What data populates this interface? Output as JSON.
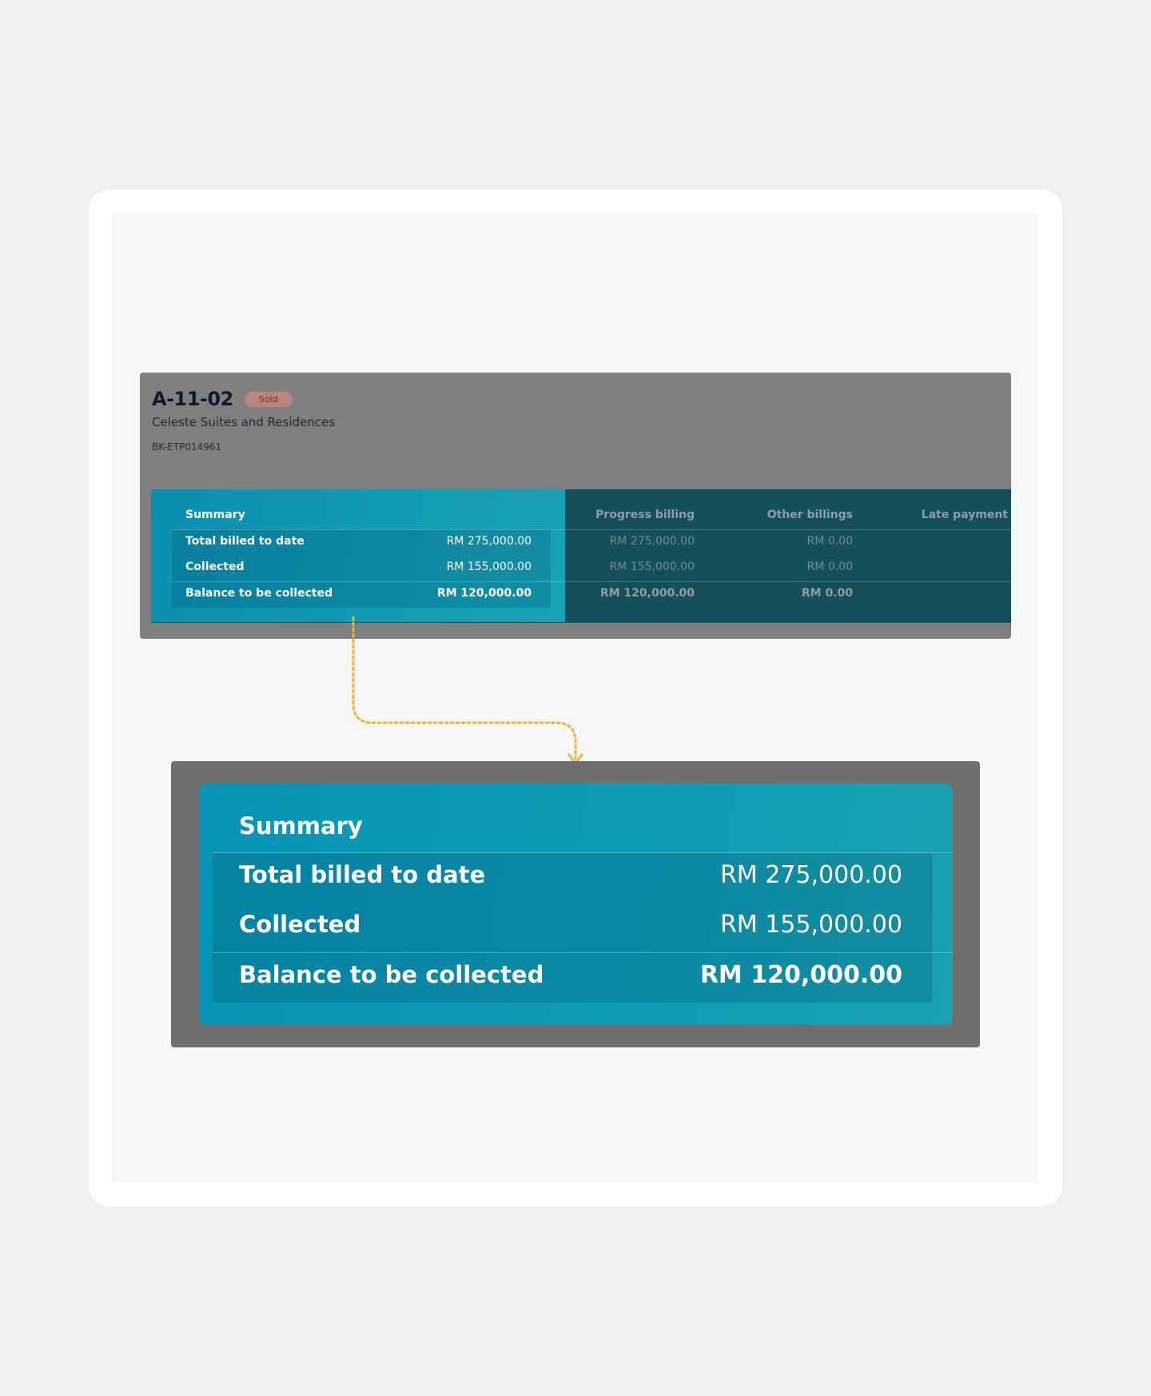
{
  "unit": {
    "code": "A-11-02",
    "status": "Sold",
    "project": "Celeste Suites and Residences",
    "booking_id": "BK-ETP014961"
  },
  "summary": {
    "header": "Summary",
    "rows": [
      {
        "label": "Total billed to date",
        "value": "RM 275,000.00"
      },
      {
        "label": "Collected",
        "value": "RM 155,000.00"
      },
      {
        "label": "Balance to be collected",
        "value": "RM 120,000.00"
      }
    ]
  },
  "columns": [
    {
      "header": "Progress billing",
      "values": [
        "RM 275,000.00",
        "RM 155,000.00",
        "RM 120,000.00"
      ]
    },
    {
      "header": "Other billings",
      "values": [
        "RM 0.00",
        "RM 0.00",
        "RM 0.00"
      ]
    },
    {
      "header": "Late payment",
      "values": []
    }
  ],
  "colors": {
    "accent": "#0b8fb0",
    "connector": "#f3b23a",
    "sold_badge": "#b88680"
  },
  "icons": {
    "connector": "dotted-arrow-icon"
  }
}
